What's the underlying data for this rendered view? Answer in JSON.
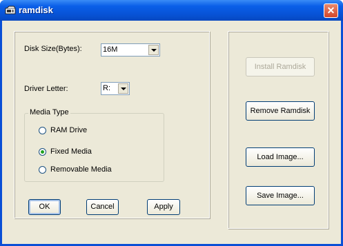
{
  "window": {
    "title": "ramdisk",
    "close_glyph": "✕"
  },
  "disk_size": {
    "label": "Disk Size(Bytes):",
    "value": "16M"
  },
  "driver_letter": {
    "label": "Driver Letter:",
    "value": "R:"
  },
  "media_type": {
    "legend": "Media Type",
    "options": [
      {
        "label": "RAM Drive",
        "checked": false
      },
      {
        "label": "Fixed Media",
        "checked": true
      },
      {
        "label": "Removable Media",
        "checked": false
      }
    ]
  },
  "buttons": {
    "ok": "OK",
    "cancel": "Cancel",
    "apply": "Apply"
  },
  "actions": {
    "install": "Install Ramdisk",
    "remove": "Remove Ramdisk",
    "load": "Load Image...",
    "save": "Save Image..."
  }
}
